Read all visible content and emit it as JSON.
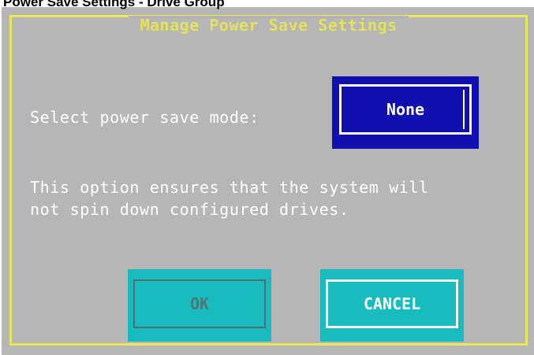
{
  "page_caption": "Power Save Settings - Drive Group",
  "dialog": {
    "title": "Manage Power Save Settings",
    "mode_label": "Select power save mode:",
    "mode_value": "None",
    "description_lines": [
      "This option ensures that the system will",
      "not spin down configured drives."
    ],
    "ok_label": "OK",
    "cancel_label": "CANCEL"
  },
  "colors": {
    "background": "#b6b6b6",
    "frame": "#e8e85a",
    "selected_field": "#1010b0",
    "button_panel": "#18bcbe",
    "text": "#ffffff"
  }
}
